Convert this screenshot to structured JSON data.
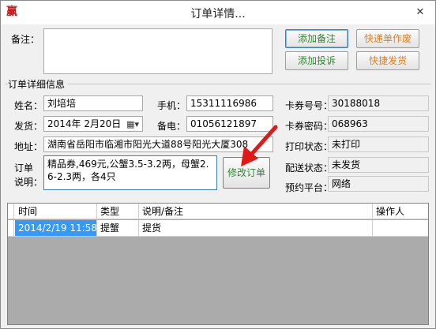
{
  "window": {
    "title": "订单详情...",
    "close_glyph": "✕",
    "app_icon_glyph": "赢"
  },
  "remark": {
    "label": "备注：",
    "value": ""
  },
  "buttons": {
    "add_remark": "添加备注",
    "add_complaint": "添加投诉",
    "express_void": "快递单作废",
    "quick_ship": "快捷发货",
    "modify_order": "修改订单"
  },
  "button_colors": {
    "green": "#2e8b2e",
    "orange": "#e08020"
  },
  "order_details": {
    "section_title": "订单详细信息",
    "name_label": "姓名：",
    "name_value": "刘培培",
    "phone_label": "手机：",
    "phone_value": "15311116986",
    "ship_label": "发货：",
    "ship_date_value": "2014年  2月20日",
    "backup_phone_label": "备电：",
    "backup_phone_value": "01056121897",
    "address_label": "地址：",
    "address_value": "湖南省岳阳市临湘市阳光大道88号阳光大厦308",
    "order_desc_label_1": "订单",
    "order_desc_label_2": "说明：",
    "order_desc_value": "精品券,469元,公蟹3.5-3.2两，母蟹2.6-2.3两，各4只",
    "card_no_label": "卡券号号：",
    "card_no_value": "30188018",
    "card_pwd_label": "卡券密码：",
    "card_pwd_value": "068963",
    "print_status_label": "打印状态：",
    "print_status_value": "未打印",
    "delivery_status_label": "配送状态：",
    "delivery_status_value": "未发货",
    "platform_label": "预约平台：",
    "platform_value": "网络"
  },
  "log_table": {
    "columns": [
      "时间",
      "类型",
      "说明/备注",
      "操作人"
    ],
    "rows": [
      {
        "time": "2014/2/19 11:58",
        "type": "提蟹",
        "note": "提货",
        "operator": ""
      }
    ]
  },
  "annotation": {
    "arrow_color": "#e01818"
  }
}
